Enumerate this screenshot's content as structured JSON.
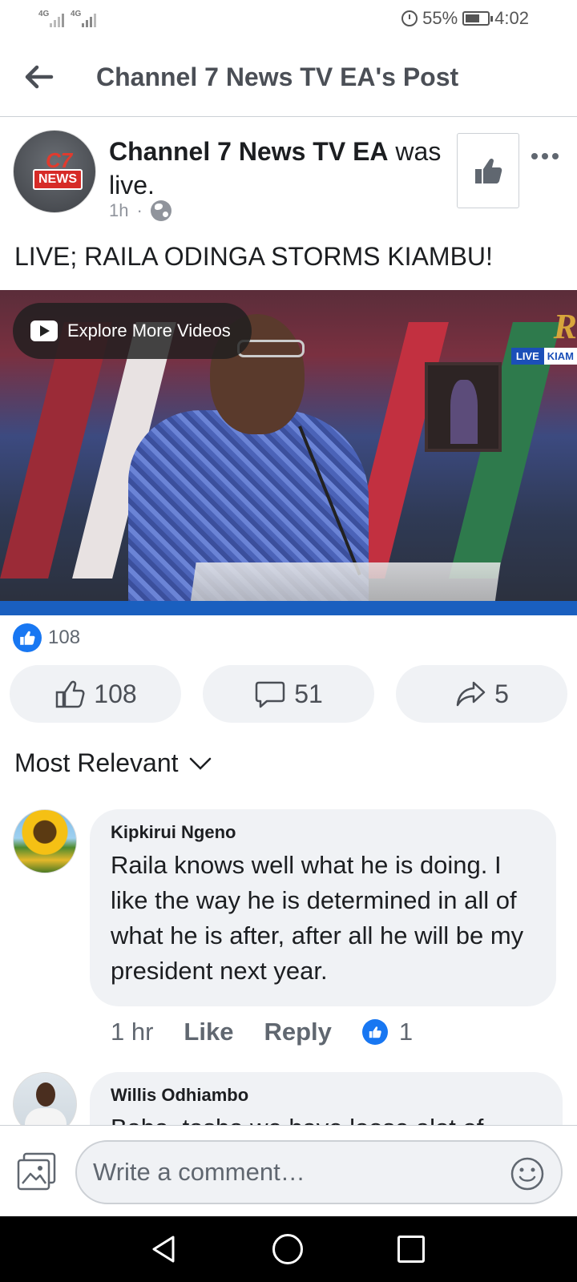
{
  "status_bar": {
    "signal_1": "4G",
    "signal_2": "4G",
    "battery": "55%",
    "time": "4:02"
  },
  "header": {
    "title": "Channel 7 News TV EA's Post"
  },
  "post": {
    "author": "Channel 7 News TV EA",
    "action": "was live.",
    "avatar_text": "NEWS",
    "avatar_mark": "C7",
    "time": "1h",
    "separator": "·",
    "text": "LIVE; RAILA ODINGA STORMS KIAMBU!",
    "video": {
      "explore_label": "Explore More Videos",
      "live_badge": "LIVE",
      "live_location": "KIAM",
      "logo_letter": "R"
    },
    "reaction_count": "108",
    "actions": {
      "like_count": "108",
      "comment_count": "51",
      "share_count": "5"
    }
  },
  "comments": {
    "sort_label": "Most Relevant",
    "items": [
      {
        "name": "Kipkirui Ngeno",
        "text": "Raila knows well what he is doing. I like the way he is determined in all of what he is after, after all he will be my president next year.",
        "time": "1 hr",
        "like_label": "Like",
        "reply_label": "Reply",
        "reactions": "1"
      },
      {
        "name": "Willis Odhiambo",
        "text": "Baba, tasha we have loose alot of"
      }
    ]
  },
  "composer": {
    "placeholder": "Write a comment…"
  },
  "colors": {
    "accent": "#1877f2",
    "bubble": "#f0f2f5",
    "muted_text": "#606770"
  }
}
